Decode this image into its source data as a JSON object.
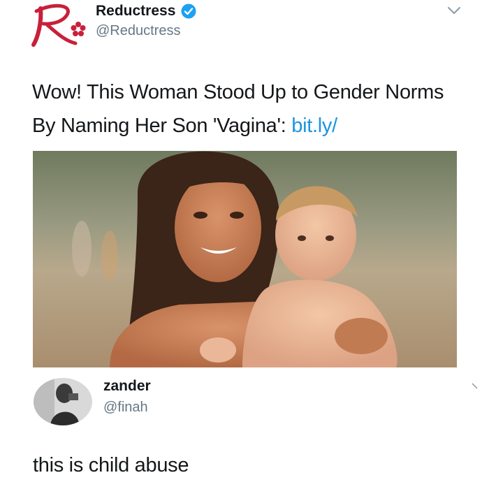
{
  "tweet": {
    "display_name": "Reductress",
    "handle": "@Reductress",
    "text_main": "Wow! This Woman Stood Up to Gender Norms By Naming Her Son 'Vagina': ",
    "link_text": "bit.ly/",
    "icons": [
      "reductress-logo",
      "verified-badge-icon",
      "chevron-down-icon"
    ],
    "colors": {
      "link": "#1b95e0",
      "verified": "#1da1f2",
      "logo": "#c8203a"
    }
  },
  "reply": {
    "display_name": "zander",
    "handle": "@finah",
    "text": "this is child abuse",
    "icons": [
      "avatar",
      "chevron-down-icon"
    ]
  }
}
